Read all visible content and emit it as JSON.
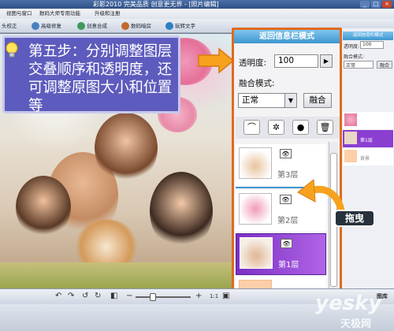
{
  "titlebar": {
    "title": "彩影2010 完美品质 创意更无界 - [照片编辑]"
  },
  "menu": [
    "视图与窗口",
    "数码大师专用功能",
    "升级和注册"
  ],
  "toolbar": {
    "items": [
      "头校正",
      "高级修复",
      "创意合成",
      "数码暗房",
      "玩转文字"
    ]
  },
  "callout": {
    "text": "第五步：分别调整图层交叠顺序和透明度，还可调整原图大小和位置等"
  },
  "layer_panel": {
    "header": "返回信息栏模式",
    "opacity_label": "透明度:",
    "opacity_value": "100",
    "blend_label": "融合模式:",
    "blend_value": "正常",
    "blend_button": "融合",
    "layers": [
      {
        "name": "第3层",
        "selected": false
      },
      {
        "name": "第2层",
        "selected": false
      },
      {
        "name": "第1层",
        "selected": true
      },
      {
        "name": "背景",
        "selected": false
      }
    ]
  },
  "drag_label": "拖曳",
  "right_panel": {
    "header": "返回信息栏模式",
    "opacity_label": "透明度:",
    "opacity_value": "100",
    "blend_label": "融合模式:",
    "blend_value": "正常",
    "blend_button": "融合",
    "layer_names": [
      "第1层",
      "背景"
    ]
  },
  "bottombar": {
    "zoom_label": "1:1"
  },
  "watermark": {
    "brand": "yesky",
    "sub": "天极网",
    "right": "图库"
  },
  "colors": {
    "accent_orange": "#e06a1e",
    "callout_purple": "#5d5bbd",
    "selected_layer": "#8b3fd0",
    "panel_header": "#3d96cf"
  }
}
